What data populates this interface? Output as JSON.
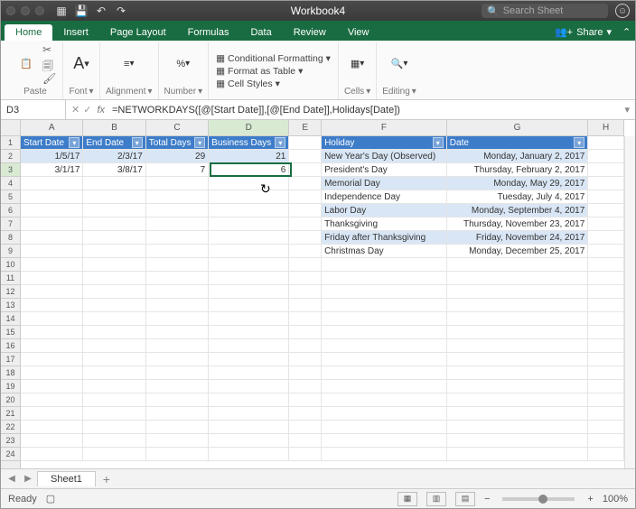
{
  "title": "Workbook4",
  "search_ph": "Search Sheet",
  "tabs": [
    "Home",
    "Insert",
    "Page Layout",
    "Formulas",
    "Data",
    "Review",
    "View"
  ],
  "share": "Share",
  "ribbon": {
    "paste": "Paste",
    "font": "Font",
    "align": "Alignment",
    "number": "Number",
    "cond": "Conditional Formatting",
    "fmt": "Format as Table",
    "styles": "Cell Styles",
    "cells": "Cells",
    "editing": "Editing"
  },
  "namebox": "D3",
  "formula": "=NETWORKDAYS([@[Start Date]],[@[End Date]],Holidays[Date])",
  "colheads": [
    "A",
    "B",
    "C",
    "D",
    "E",
    "F",
    "G",
    "H"
  ],
  "rowcount": 24,
  "active": {
    "row": 3,
    "col": "D"
  },
  "table1": {
    "headers": [
      "Start Date",
      "End Date",
      "Total Days",
      "Business Days"
    ],
    "rows": [
      [
        "1/5/17",
        "2/3/17",
        "29",
        "21"
      ],
      [
        "3/1/17",
        "3/8/17",
        "7",
        "6"
      ]
    ]
  },
  "table2": {
    "headers": [
      "Holiday",
      "Date"
    ],
    "rows": [
      [
        "New Year's Day (Observed)",
        "Monday, January 2, 2017"
      ],
      [
        "President's Day",
        "Thursday, February 2, 2017"
      ],
      [
        "Memorial Day",
        "Monday, May 29, 2017"
      ],
      [
        "Independence Day",
        "Tuesday, July 4, 2017"
      ],
      [
        "Labor Day",
        "Monday, September 4, 2017"
      ],
      [
        "Thanksgiving",
        "Thursday, November 23, 2017"
      ],
      [
        "Friday after Thanksgiving",
        "Friday, November 24, 2017"
      ],
      [
        "Christmas Day",
        "Monday, December 25, 2017"
      ]
    ]
  },
  "sheet": "Sheet1",
  "status": "Ready",
  "zoom": "100%"
}
